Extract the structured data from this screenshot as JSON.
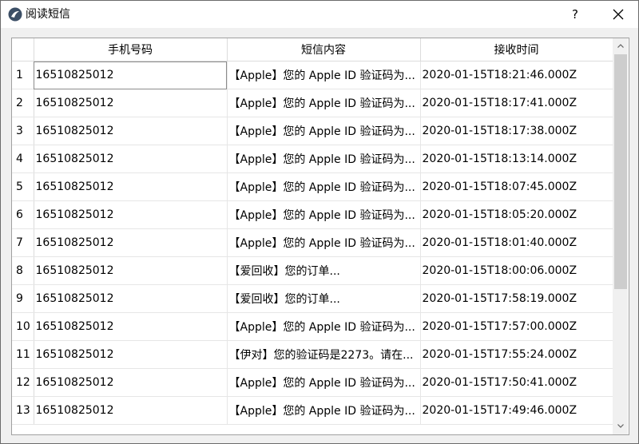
{
  "window": {
    "title": "阅读短信",
    "help_label": "?"
  },
  "table": {
    "columns": [
      "手机号码",
      "短信内容",
      "接收时间"
    ],
    "rows": [
      {
        "num": "1",
        "phone": "16510825012",
        "content": "【Apple】您的 Apple ID 验证码为...",
        "time": "2020-01-15T18:21:46.000Z"
      },
      {
        "num": "2",
        "phone": "16510825012",
        "content": "【Apple】您的 Apple ID 验证码为...",
        "time": "2020-01-15T18:17:41.000Z"
      },
      {
        "num": "3",
        "phone": "16510825012",
        "content": "【Apple】您的 Apple ID 验证码为...",
        "time": "2020-01-15T18:17:38.000Z"
      },
      {
        "num": "4",
        "phone": "16510825012",
        "content": "【Apple】您的 Apple ID 验证码为...",
        "time": "2020-01-15T18:13:14.000Z"
      },
      {
        "num": "5",
        "phone": "16510825012",
        "content": "【Apple】您的 Apple ID 验证码为...",
        "time": "2020-01-15T18:07:45.000Z"
      },
      {
        "num": "6",
        "phone": "16510825012",
        "content": "【Apple】您的 Apple ID 验证码为...",
        "time": "2020-01-15T18:05:20.000Z"
      },
      {
        "num": "7",
        "phone": "16510825012",
        "content": "【Apple】您的 Apple ID 验证码为...",
        "time": "2020-01-15T18:01:40.000Z"
      },
      {
        "num": "8",
        "phone": "16510825012",
        "content": "【爱回收】您的订单...",
        "time": "2020-01-15T18:00:06.000Z"
      },
      {
        "num": "9",
        "phone": "16510825012",
        "content": "【爱回收】您的订单...",
        "time": "2020-01-15T17:58:19.000Z"
      },
      {
        "num": "10",
        "phone": "16510825012",
        "content": "【Apple】您的 Apple ID 验证码为...",
        "time": "2020-01-15T17:57:00.000Z"
      },
      {
        "num": "11",
        "phone": "16510825012",
        "content": "【伊对】您的验证码是2273。请在...",
        "time": "2020-01-15T17:55:24.000Z"
      },
      {
        "num": "12",
        "phone": "16510825012",
        "content": "【Apple】您的 Apple ID 验证码为...",
        "time": "2020-01-15T17:50:41.000Z"
      },
      {
        "num": "13",
        "phone": "16510825012",
        "content": "【Apple】您的 Apple ID 验证码为...",
        "time": "2020-01-15T17:49:46.000Z"
      }
    ]
  }
}
